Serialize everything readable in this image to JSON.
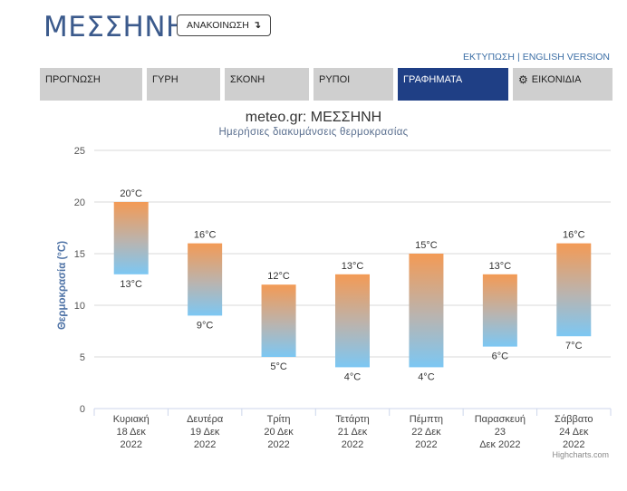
{
  "header": {
    "city": "ΜΕΣΣΗΝΗ",
    "announce_label": "ΑΝΑΚΟΙΝΩΣΗ",
    "announce_icon": "arrow-down-icon"
  },
  "top_links": {
    "print": "ΕΚΤΥΠΩΣΗ",
    "separator": "|",
    "english": "ENGLISH VERSION"
  },
  "nav": {
    "tabs": [
      {
        "label": "ΠΡΟΓΝΩΣΗ",
        "active": false
      },
      {
        "label": "ΓΥΡΗ",
        "active": false
      },
      {
        "label": "ΣΚΟΝΗ",
        "active": false
      },
      {
        "label": "ΡΥΠΟΙ",
        "active": false
      },
      {
        "label": "ΓΡΑΦΗΜΑΤΑ",
        "active": true
      },
      {
        "label": "ΕΙΚΟΝΙΔΙΑ",
        "active": false,
        "icon": "gear-icon"
      }
    ]
  },
  "colors": {
    "accent": "#1f3f85",
    "title_blue": "#3b5a8c",
    "bar_top": "#f39a55",
    "bar_bottom": "#7cc7f3"
  },
  "chart_data": {
    "type": "bar",
    "title": "meteo.gr: ΜΕΣΣΗΝΗ",
    "subtitle": "Ημερήσιες διακυμάνσεις θερμοκρασίας",
    "ylabel": "Θερμοκρασία (°C)",
    "ylim": [
      0,
      25
    ],
    "yticks": [
      0,
      5,
      10,
      15,
      20,
      25
    ],
    "grid": true,
    "categories": [
      [
        "Κυριακή",
        "18 Δεκ",
        "2022"
      ],
      [
        "Δευτέρα",
        "19 Δεκ",
        "2022"
      ],
      [
        "Τρίτη",
        "20 Δεκ",
        "2022"
      ],
      [
        "Τετάρτη",
        "21 Δεκ",
        "2022"
      ],
      [
        "Πέμπτη",
        "22 Δεκ",
        "2022"
      ],
      [
        "Παρασκευή",
        "23",
        "Δεκ 2022"
      ],
      [
        "Σάββατο",
        "24 Δεκ",
        "2022"
      ]
    ],
    "series": [
      {
        "low": [
          13,
          9,
          5,
          4,
          4,
          6,
          7
        ],
        "high": [
          20,
          16,
          12,
          13,
          15,
          13,
          16
        ]
      }
    ],
    "label_unit": "°C"
  },
  "credits": "Highcharts.com"
}
